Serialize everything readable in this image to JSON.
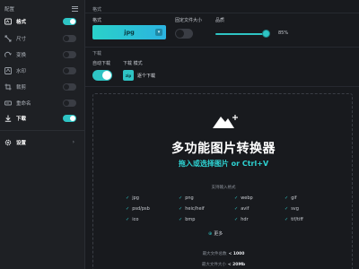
{
  "sidebar": {
    "title": "配置",
    "items": [
      {
        "label": "格式",
        "active": true,
        "toggle": true,
        "icon": "format-icon"
      },
      {
        "label": "尺寸",
        "active": false,
        "toggle": false,
        "icon": "resize-icon"
      },
      {
        "label": "变换",
        "active": false,
        "toggle": false,
        "icon": "transform-icon"
      },
      {
        "label": "水印",
        "active": false,
        "toggle": false,
        "icon": "watermark-icon"
      },
      {
        "label": "裁剪",
        "active": false,
        "toggle": false,
        "icon": "crop-icon"
      },
      {
        "label": "重命名",
        "active": false,
        "toggle": false,
        "icon": "rename-icon"
      },
      {
        "label": "下载",
        "active": true,
        "toggle": true,
        "icon": "download-icon"
      }
    ],
    "settings_label": "设置",
    "settings_chevron": "›"
  },
  "format_section": {
    "title": "格式",
    "format_label": "格式",
    "format_value": "jpg",
    "fixed_size_label": "固定文件大小",
    "fixed_size_on": false,
    "quality_label": "品质",
    "quality_value": "85%",
    "quality": 0.85
  },
  "download_section": {
    "title": "下载",
    "auto_download_label": "自动下载",
    "auto_download_on": true,
    "download_mode_label": "下载 模式",
    "mode_chip": "zip",
    "mode_text": "逐个下载"
  },
  "dropzone": {
    "title": "多功能图片转换器",
    "subtitle": "拖入或选择图片 or Ctrl+V",
    "supported_label": "支持输入格式",
    "formats": [
      [
        "jpg",
        "png",
        "webp",
        "gif"
      ],
      [
        "psd/psb",
        "heic/heif",
        "avif",
        "svg"
      ],
      [
        "ico",
        "bmp",
        "hdr",
        "tif/tiff"
      ]
    ],
    "more_label": "更多",
    "limit_count_label": "最大文件总数",
    "limit_count_value": "< 1000",
    "limit_size_label": "最大文件大小",
    "limit_size_value": "< 20Mb"
  },
  "colors": {
    "accent": "#2ec4c4",
    "background": "#181a1e",
    "sidebar": "#1e2024"
  }
}
